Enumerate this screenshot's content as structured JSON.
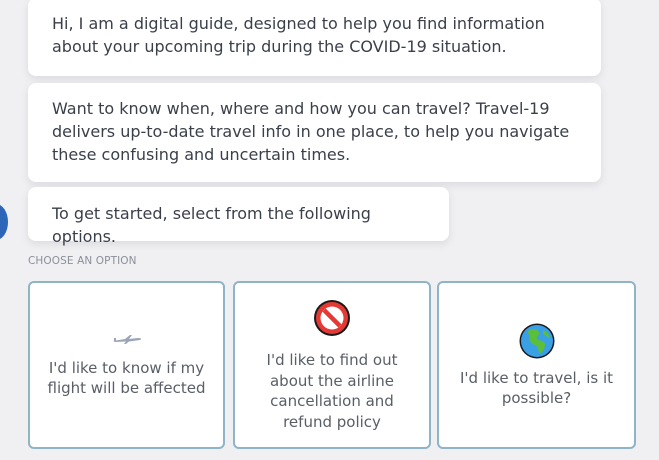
{
  "messages": [
    "Hi, I am a digital guide, designed to help you find information about your upcoming trip during the COVID-19 situation.",
    "Want to know when, where and how you can travel? Travel-19 delivers up-to-date travel info in one place, to help you navigate these confusing and uncertain times.",
    "To get started, select from the following options."
  ],
  "choose_label": "CHOOSE AN OPTION",
  "options": [
    {
      "label": "I'd like to know if my flight will be affected",
      "icon": "airplane-icon"
    },
    {
      "label": "I'd like to find out about the airline cancellation and refund policy",
      "icon": "prohibited-icon"
    },
    {
      "label": "I'd like to travel, is it possible?",
      "icon": "globe-icon"
    }
  ],
  "colors": {
    "background": "#f0f0f2",
    "card_border": "#8fb3c7",
    "avatar": "#2d66b8"
  }
}
